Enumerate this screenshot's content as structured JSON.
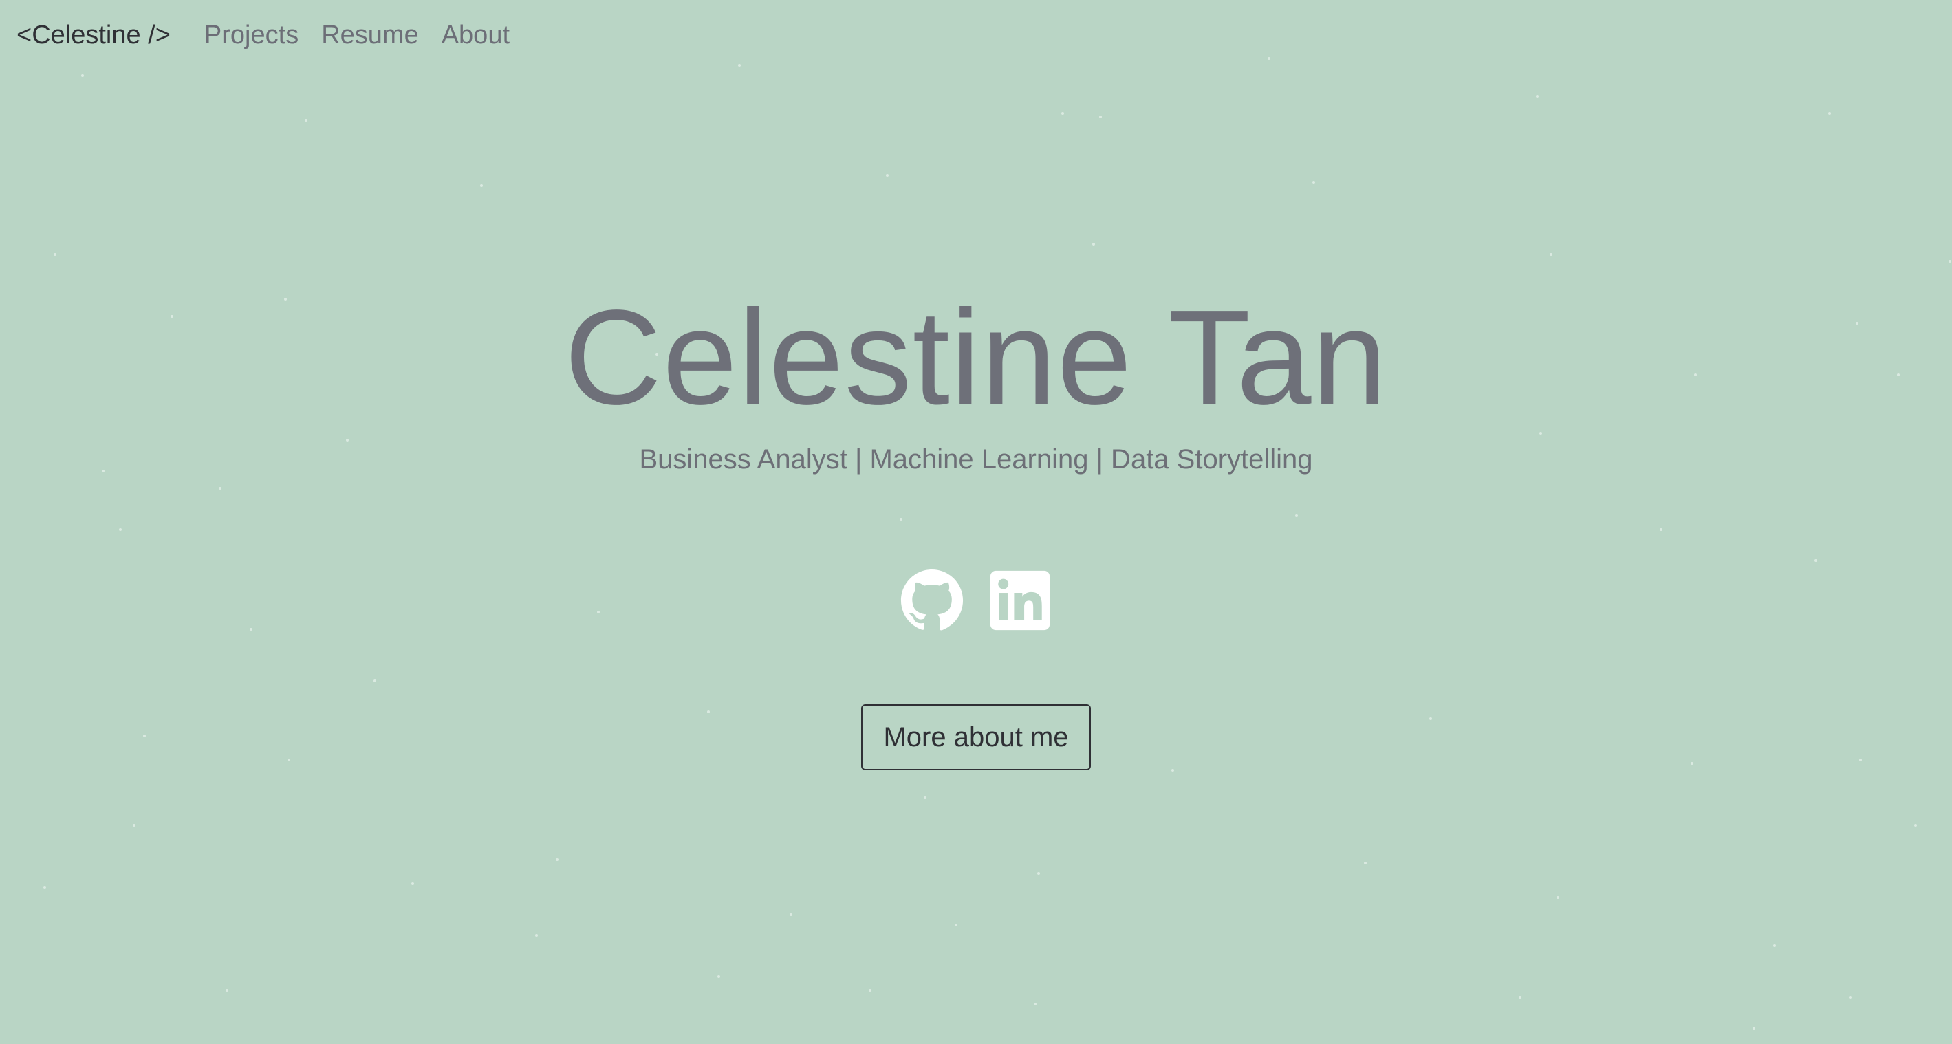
{
  "nav": {
    "brand": "<Celestine />",
    "links": [
      "Projects",
      "Resume",
      "About"
    ]
  },
  "hero": {
    "name": "Celestine Tan",
    "tagline": "Business Analyst | Machine Learning | Data Storytelling"
  },
  "socials": [
    {
      "icon": "github-icon"
    },
    {
      "icon": "linkedin-icon"
    }
  ],
  "cta": {
    "label": "More about me"
  },
  "colors": {
    "background": "#b9d5c5",
    "text_primary": "#2f3035",
    "text_muted": "#6e7079",
    "icon": "#ffffff"
  }
}
